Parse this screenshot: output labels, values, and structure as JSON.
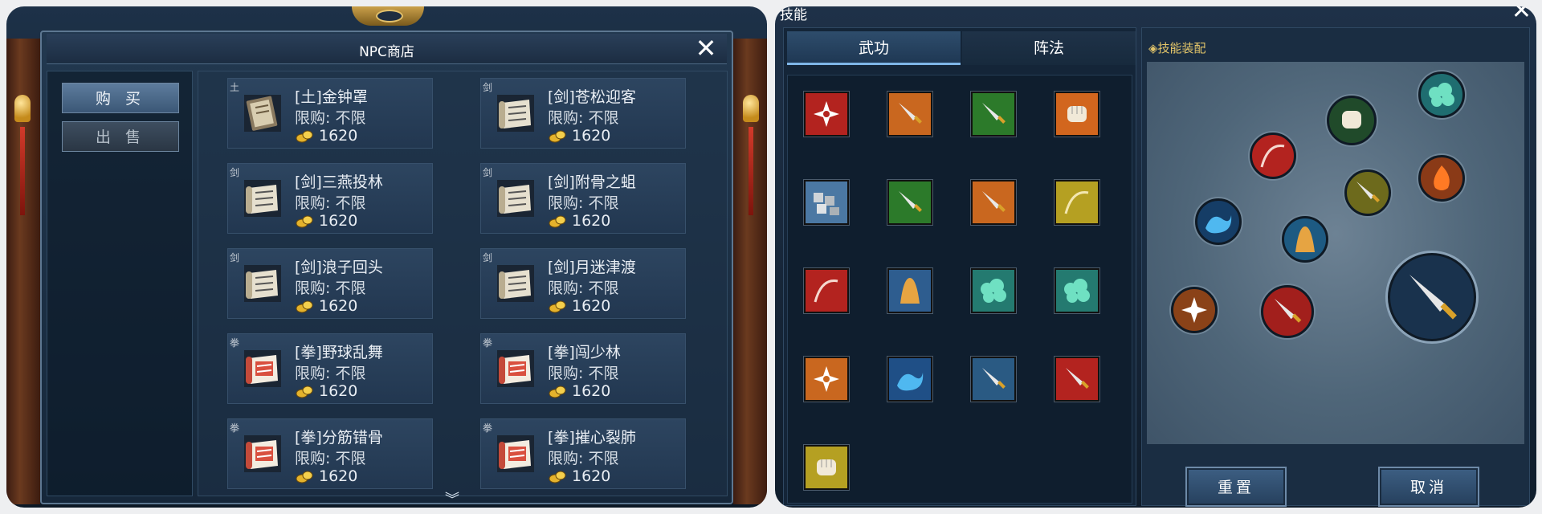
{
  "shop": {
    "title": "NPC商店",
    "close_icon": "close-icon",
    "tabs": {
      "buy": "购 买",
      "sell": "出 售"
    },
    "items": [
      {
        "cat": "土",
        "name": "[土]金钟罩",
        "limit": "限购: 不限",
        "price": "1620",
        "icon": "book-icon"
      },
      {
        "cat": "剑",
        "name": "[剑]苍松迎客",
        "limit": "限购: 不限",
        "price": "1620",
        "icon": "scroll-icon"
      },
      {
        "cat": "剑",
        "name": "[剑]三燕投林",
        "limit": "限购: 不限",
        "price": "1620",
        "icon": "scroll-icon"
      },
      {
        "cat": "剑",
        "name": "[剑]附骨之蛆",
        "limit": "限购: 不限",
        "price": "1620",
        "icon": "scroll-icon"
      },
      {
        "cat": "剑",
        "name": "[剑]浪子回头",
        "limit": "限购: 不限",
        "price": "1620",
        "icon": "scroll-icon"
      },
      {
        "cat": "剑",
        "name": "[剑]月迷津渡",
        "limit": "限购: 不限",
        "price": "1620",
        "icon": "scroll-icon"
      },
      {
        "cat": "拳",
        "name": "[拳]野球乱舞",
        "limit": "限购: 不限",
        "price": "1620",
        "icon": "red-scroll-icon"
      },
      {
        "cat": "拳",
        "name": "[拳]闯少林",
        "limit": "限购: 不限",
        "price": "1620",
        "icon": "red-scroll-icon"
      },
      {
        "cat": "拳",
        "name": "[拳]分筋错骨",
        "limit": "限购: 不限",
        "price": "1620",
        "icon": "red-scroll-icon"
      },
      {
        "cat": "拳",
        "name": "[拳]摧心裂肺",
        "limit": "限购: 不限",
        "price": "1620",
        "icon": "red-scroll-icon"
      }
    ]
  },
  "skills": {
    "title": "技能",
    "tabs": {
      "martial": "武功",
      "formation": "阵法"
    },
    "equip_header": "◈技能装配",
    "buttons": {
      "reset": "重置",
      "cancel": "取消"
    },
    "grid_icons": [
      "shuriken-icon",
      "dagger-icon",
      "dagger-icon",
      "fist-icon",
      "stone-icon",
      "dagger-icon",
      "dagger-icon",
      "whip-icon",
      "whip-icon",
      "claw-icon",
      "cloud-icon",
      "cloud-icon",
      "shuriken-icon",
      "wave-icon",
      "dagger-icon",
      "dagger-icon",
      "fist-icon"
    ],
    "slot_icons": [
      "fist-icon",
      "cloud-icon",
      "whip-icon",
      "dagger-icon",
      "flame-icon",
      "wave-icon",
      "claw-icon",
      "shuriken-icon",
      "dagger-icon",
      "sword-icon"
    ]
  }
}
